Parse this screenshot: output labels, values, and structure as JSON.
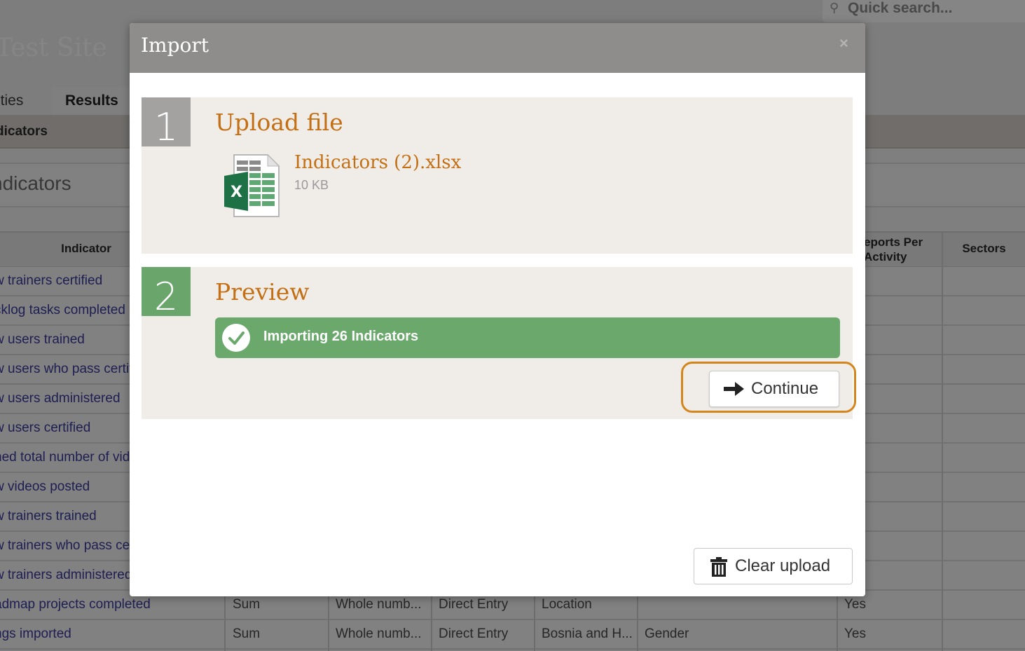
{
  "page": {
    "site_title": "Test Site",
    "search_placeholder": "Quick search...",
    "tabs": [
      {
        "label": "ities"
      },
      {
        "label": "Results"
      }
    ],
    "subnav_item": "dicators",
    "heading": "ndicators",
    "table": {
      "headers": {
        "indicator": "Indicator",
        "reports_per_activity_line1": "eports Per",
        "reports_per_activity_line2": "Activity",
        "sectors": "Sectors"
      },
      "rows": [
        "w trainers certified",
        "cklog tasks completed",
        "w users trained",
        "w users who pass certification",
        "w users administered",
        "w users certified",
        "ned total number of videos",
        "w videos posted",
        "w trainers trained",
        "w trainers who pass certification",
        "w trainers administered"
      ],
      "full_rows": [
        {
          "name": "admap projects completed",
          "aggregation": "Sum",
          "unit": "Whole numb...",
          "entry": "Direct Entry",
          "disaggregation": "Location",
          "extra": "",
          "reports": "Yes"
        },
        {
          "name": "ngs imported",
          "aggregation": "Sum",
          "unit": "Whole numb...",
          "entry": "Direct Entry",
          "disaggregation": "Bosnia and H...",
          "extra": "Gender",
          "reports": "Yes"
        }
      ]
    }
  },
  "modal": {
    "title": "Import",
    "close_symbol": "×",
    "step1": {
      "number": "1",
      "title": "Upload file",
      "file_name": "Indicators (2).xlsx",
      "file_size": "10 KB"
    },
    "step2": {
      "number": "2",
      "title": "Preview",
      "status_text": "Importing 26 Indicators",
      "continue_label": "Continue"
    },
    "clear_label": "Clear upload"
  },
  "colors": {
    "accent_orange": "#c46f13",
    "success_green": "#6aa86c",
    "modal_header": "#8e8d8b"
  }
}
